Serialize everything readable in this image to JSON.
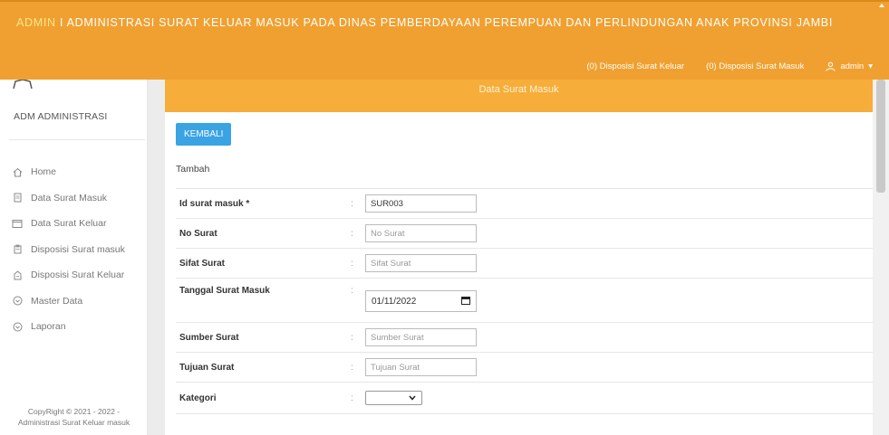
{
  "header": {
    "brand": "ADMIN",
    "title": " I ADMINISTRASI SURAT KELUAR MASUK PADA DINAS PEMBERDAYAAN PEREMPUAN DAN PERLINDUNGAN ANAK PROVINSI JAMBI",
    "nav": {
      "disposisi_keluar": "(0) Disposisi Surat Keluar",
      "disposisi_masuk": "(0) Disposisi Surat Masuk",
      "user": "admin",
      "user_caret": "▾"
    }
  },
  "sidebar": {
    "brand": "ADM ADMINISTRASI",
    "items": [
      {
        "label": "Home",
        "icon": "home-icon"
      },
      {
        "label": "Data Surat Masuk",
        "icon": "document-icon"
      },
      {
        "label": "Data Surat Keluar",
        "icon": "window-icon"
      },
      {
        "label": "Disposisi Surat masuk",
        "icon": "clipboard-icon"
      },
      {
        "label": "Disposisi Surat Keluar",
        "icon": "inbox-icon"
      },
      {
        "label": "Master Data",
        "icon": "circle-chevron-icon"
      },
      {
        "label": "Laporan",
        "icon": "circle-chevron-icon"
      }
    ],
    "copyright_line1": "CopyRight © 2021 - 2022 -",
    "copyright_line2": "Administrasi Surat Keluar masuk"
  },
  "main": {
    "panel_title": "Data Surat Masuk",
    "back_label": "KEMBALI",
    "section_label": "Tambah",
    "colon": ":",
    "fields": [
      {
        "label": "Id surat masuk *",
        "value": "SUR003",
        "placeholder": ""
      },
      {
        "label": "No Surat",
        "value": "",
        "placeholder": "No Surat"
      },
      {
        "label": "Sifat Surat",
        "value": "",
        "placeholder": "Sifat Surat"
      },
      {
        "label": "Tanggal Surat Masuk",
        "value": "01/11/2022",
        "placeholder": ""
      },
      {
        "label": "Sumber Surat",
        "value": "",
        "placeholder": "Sumber Surat"
      },
      {
        "label": "Tujuan Surat",
        "value": "",
        "placeholder": "Tujuan Surat"
      },
      {
        "label": "Kategori",
        "value": "",
        "placeholder": ""
      }
    ]
  },
  "colors": {
    "header_bg": "#f0a030",
    "panel_bg": "#f7ad3a",
    "button_bg": "#3aa3e3",
    "brand_text": "#fde68a"
  }
}
